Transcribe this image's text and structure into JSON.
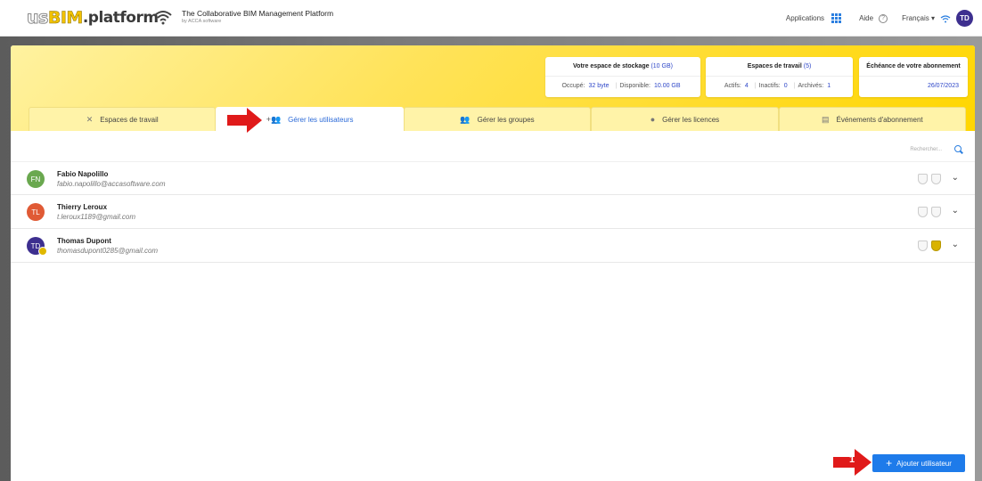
{
  "header": {
    "logo_us": "us",
    "logo_bim": "BIM",
    "logo_platform": ".platform",
    "tagline": "The Collaborative BIM Management Platform",
    "tagline_sub": "by ACCA software",
    "applications_label": "Applications",
    "help_label": "Aide",
    "language_label": "Français ▾",
    "user_initials": "TD"
  },
  "storage": {
    "title": "Votre espace de stockage",
    "size": "(10 GB)",
    "used_label": "Occupé:",
    "used_value": "32 byte",
    "available_label": "Disponible:",
    "available_value": "10.00 GB"
  },
  "workspaces": {
    "title": "Espaces de travail",
    "count": "(5)",
    "active_label": "Actifs:",
    "active_value": "4",
    "inactive_label": "Inactifs:",
    "inactive_value": "0",
    "archived_label": "Archivés:",
    "archived_value": "1"
  },
  "subscription": {
    "title": "Échéance de votre abonnement",
    "date": "26/07/2023"
  },
  "tabs": [
    {
      "label": "Espaces de travail",
      "icon": "tools-icon"
    },
    {
      "label": "Gérer les utilisateurs",
      "icon": "users-add-icon"
    },
    {
      "label": "Gérer les groupes",
      "icon": "groups-icon"
    },
    {
      "label": "Gérer les licences",
      "icon": "user-circle-icon"
    },
    {
      "label": "Événements d'abonnement",
      "icon": "document-icon"
    }
  ],
  "search": {
    "placeholder": "Rechercher..."
  },
  "users": [
    {
      "initials": "FN",
      "name": "Fabio Napolillo",
      "email": "fabio.napolillo@accasoftware.com",
      "color": "#6aa84f"
    },
    {
      "initials": "TL",
      "name": "Thierry Leroux",
      "email": "t.leroux1189@gmail.com",
      "color": "#e05a35"
    },
    {
      "initials": "TD",
      "name": "Thomas Dupont",
      "email": "thomasdupont0285@gmail.com",
      "color": "#3d2f8f"
    }
  ],
  "add_user_button": {
    "label": "Ajouter utilisateur",
    "plus": "+"
  },
  "annotation": {
    "step_number": "1"
  },
  "colors": {
    "accent": "#1e7bea",
    "yellow": "#ffd600",
    "annotation": "#e01a1a"
  }
}
